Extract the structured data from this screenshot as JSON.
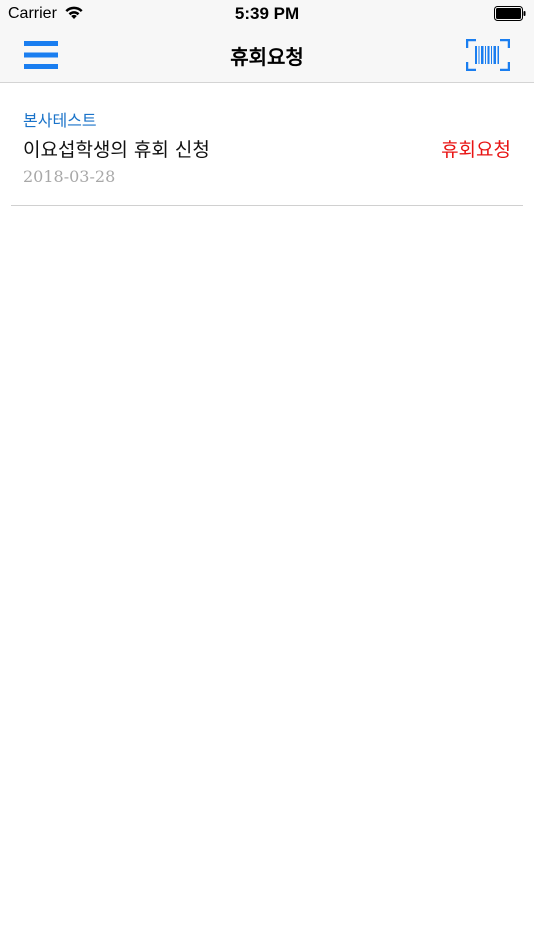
{
  "status_bar": {
    "carrier": "Carrier",
    "time": "5:39 PM"
  },
  "nav": {
    "title": "휴회요청",
    "menu_icon": "hamburger-menu-icon",
    "barcode_icon": "barcode-scan-icon",
    "accent_color": "#1a7ef0"
  },
  "list": {
    "items": [
      {
        "category": "본사테스트",
        "title": "이요섭학생의 휴회 신청",
        "status": "휴회요청",
        "date": "2018-03-28"
      }
    ]
  },
  "colors": {
    "category": "#1a73c9",
    "status": "#e81414",
    "date": "#a8a8a8"
  }
}
